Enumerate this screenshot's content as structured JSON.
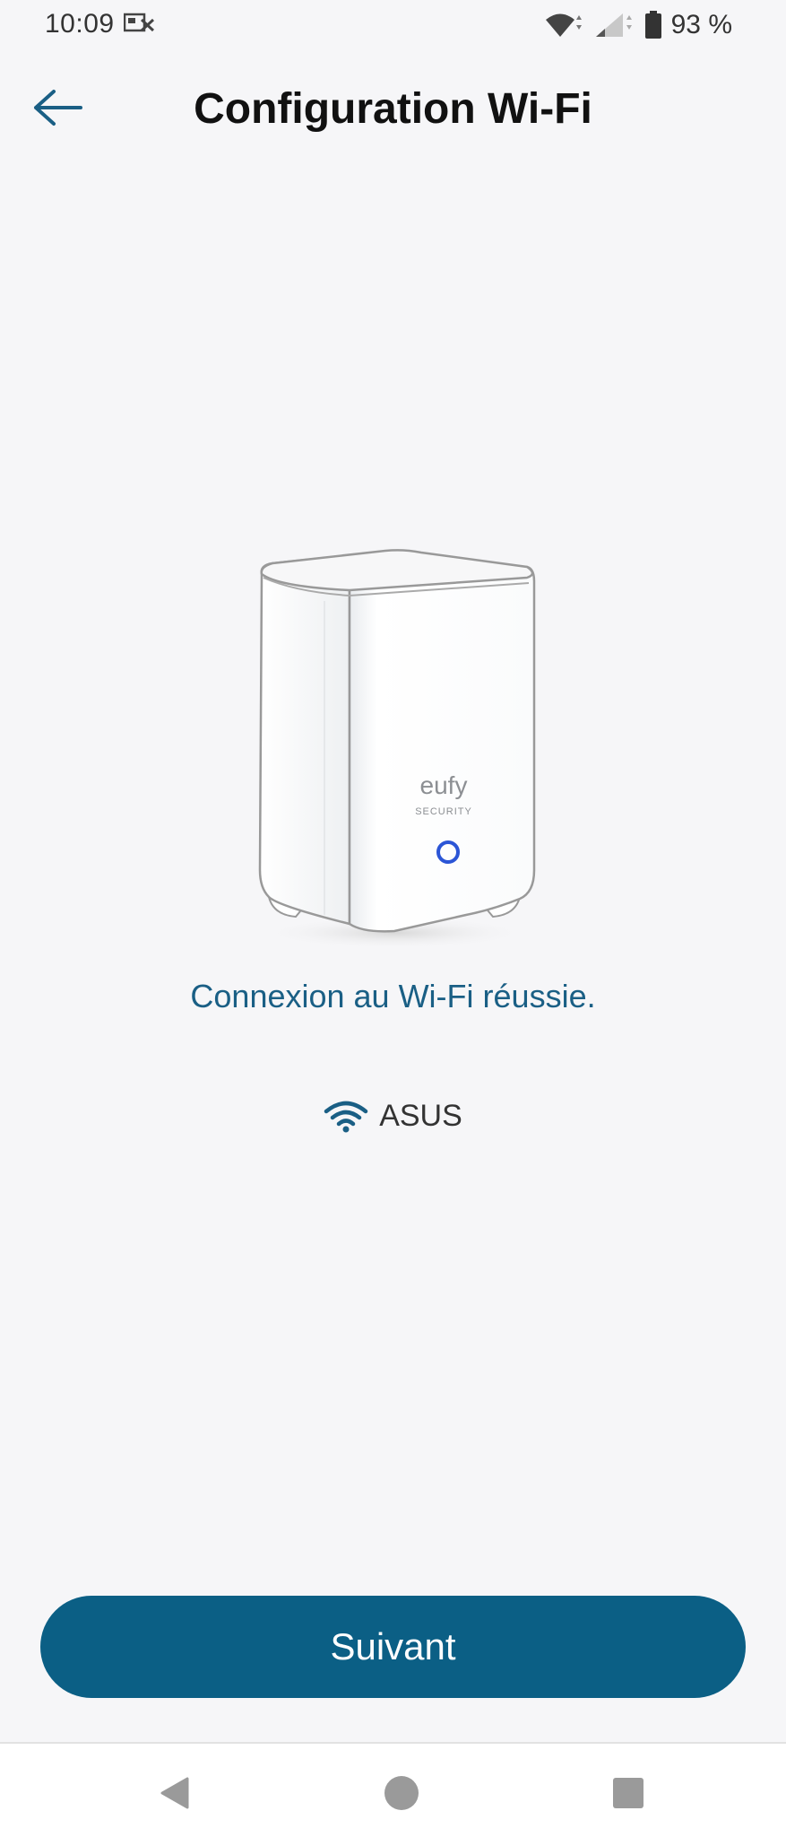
{
  "status_bar": {
    "time": "10:09",
    "battery": "93 %",
    "icons": [
      "notification-icon",
      "wifi-signal-icon",
      "cell-signal-icon",
      "battery-icon"
    ]
  },
  "header": {
    "title": "Configuration Wi-Fi",
    "back_icon": "arrow-left-icon"
  },
  "device": {
    "brand": "eufy",
    "brand_sub": "SECURITY"
  },
  "message": "Connexion au Wi-Fi réussie.",
  "network": {
    "icon": "wifi-icon",
    "name": "ASUS"
  },
  "next_button_label": "Suivant",
  "colors": {
    "accent": "#0b5f85",
    "message": "#1a5f85",
    "background": "#f6f6f8"
  },
  "nav_bar": {
    "icons": [
      "back-triangle-icon",
      "home-circle-icon",
      "recents-square-icon"
    ]
  }
}
